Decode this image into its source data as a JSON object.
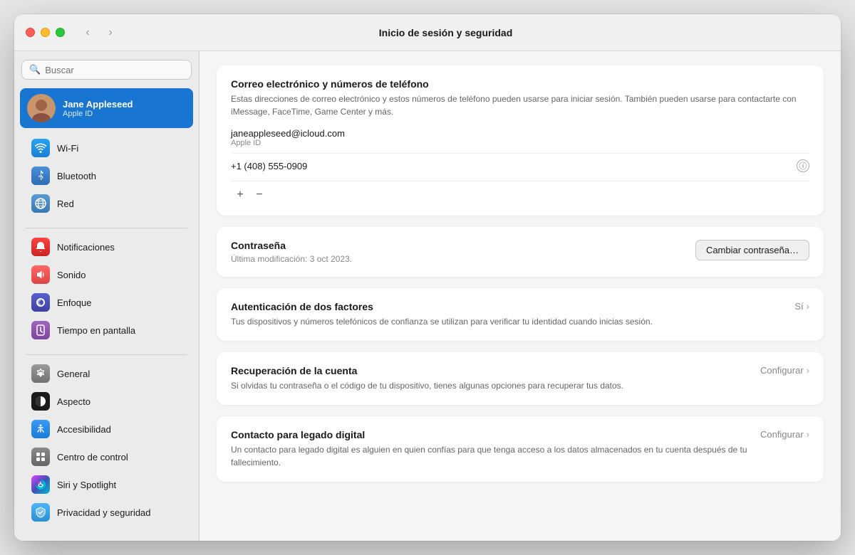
{
  "window": {
    "title": "Inicio de sesión y seguridad",
    "trafficLights": {
      "close": "close",
      "minimize": "minimize",
      "maximize": "maximize"
    }
  },
  "nav": {
    "back": "‹",
    "forward": "›"
  },
  "sidebar": {
    "search_placeholder": "Buscar",
    "user": {
      "name": "Jane Appleseed",
      "subtitle": "Apple ID"
    },
    "sections": [
      {
        "items": [
          {
            "id": "wifi",
            "label": "Wi-Fi",
            "iconClass": "icon-wifi",
            "icon": "📶"
          },
          {
            "id": "bluetooth",
            "label": "Bluetooth",
            "iconClass": "icon-bluetooth",
            "icon": "✦"
          },
          {
            "id": "network",
            "label": "Red",
            "iconClass": "icon-network",
            "icon": "🌐"
          }
        ]
      },
      {
        "items": [
          {
            "id": "notifications",
            "label": "Notificaciones",
            "iconClass": "icon-notifications",
            "icon": "🔔"
          },
          {
            "id": "sound",
            "label": "Sonido",
            "iconClass": "icon-sound",
            "icon": "🔊"
          },
          {
            "id": "focus",
            "label": "Enfoque",
            "iconClass": "icon-focus",
            "icon": "🌙"
          },
          {
            "id": "screentime",
            "label": "Tiempo en pantalla",
            "iconClass": "icon-screentime",
            "icon": "⏳"
          }
        ]
      },
      {
        "items": [
          {
            "id": "general",
            "label": "General",
            "iconClass": "icon-general",
            "icon": "⚙"
          },
          {
            "id": "appearance",
            "label": "Aspecto",
            "iconClass": "icon-appearance",
            "icon": "◑"
          },
          {
            "id": "accessibility",
            "label": "Accesibilidad",
            "iconClass": "icon-accessibility",
            "icon": "♿"
          },
          {
            "id": "controlcenter",
            "label": "Centro de control",
            "iconClass": "icon-controlcenter",
            "icon": "▦"
          },
          {
            "id": "siri",
            "label": "Siri y Spotlight",
            "iconClass": "icon-siri",
            "icon": "◎"
          },
          {
            "id": "privacy",
            "label": "Privacidad y seguridad",
            "iconClass": "icon-privacy",
            "icon": "✋"
          }
        ]
      }
    ]
  },
  "main": {
    "emailSection": {
      "title": "Correo electrónico y números de teléfono",
      "description": "Estas direcciones de correo electrónico y estos números de teléfono pueden usarse para iniciar sesión. También pueden usarse para contactarte con iMessage, FaceTime, Game Center y más.",
      "email": "janeappleseed@icloud.com",
      "emailLabel": "Apple ID",
      "phone": "+1 (408) 555-0909",
      "addBtn": "+",
      "removeBtn": "−"
    },
    "passwordSection": {
      "title": "Contraseña",
      "lastModified": "Última modificación: 3 oct 2023.",
      "changeBtn": "Cambiar contraseña…"
    },
    "twoFactorSection": {
      "title": "Autenticación de dos factores",
      "description": "Tus dispositivos y números telefónicos de confianza se utilizan para verificar tu identidad cuando inicias sesión.",
      "status": "Sí"
    },
    "recoverySection": {
      "title": "Recuperación de la cuenta",
      "description": "Si olvidas tu contraseña o el código de tu dispositivo, tienes algunas opciones para recuperar tus datos.",
      "action": "Configurar"
    },
    "legacySection": {
      "title": "Contacto para legado digital",
      "description": "Un contacto para legado digital es alguien en quien confías para que tenga acceso a los datos almacenados en tu cuenta después de tu fallecimiento.",
      "action": "Configurar"
    }
  }
}
